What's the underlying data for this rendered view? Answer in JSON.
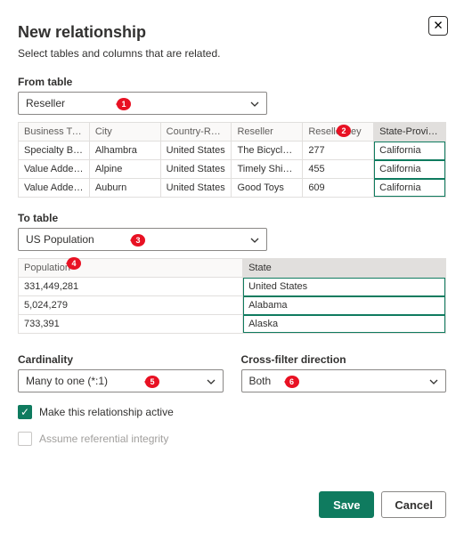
{
  "title": "New relationship",
  "subtitle": "Select tables and columns that are related.",
  "close_icon": "✕",
  "from": {
    "label": "From table",
    "selected": "Reseller",
    "columns": [
      "Business Type",
      "City",
      "Country-Regi…",
      "Reseller",
      "ResellerKey",
      "State-Province"
    ],
    "rows": [
      [
        "Specialty Bike…",
        "Alhambra",
        "United States",
        "The Bicycle A…",
        "277",
        "California"
      ],
      [
        "Value Added …",
        "Alpine",
        "United States",
        "Timely Shippi…",
        "455",
        "California"
      ],
      [
        "Value Added …",
        "Auburn",
        "United States",
        "Good Toys",
        "609",
        "California"
      ]
    ],
    "selected_col_index": 5
  },
  "to": {
    "label": "To table",
    "selected": "US Population",
    "columns": [
      "Population",
      "State"
    ],
    "rows": [
      [
        "331,449,281",
        "United States"
      ],
      [
        "5,024,279",
        "Alabama"
      ],
      [
        "733,391",
        "Alaska"
      ]
    ],
    "selected_col_index": 1
  },
  "cardinality": {
    "label": "Cardinality",
    "selected": "Many to one (*:1)"
  },
  "crossfilter": {
    "label": "Cross-filter direction",
    "selected": "Both"
  },
  "check_active": {
    "label": "Make this relationship active",
    "checked": true
  },
  "check_referential": {
    "label": "Assume referential integrity",
    "checked": false,
    "disabled": true
  },
  "buttons": {
    "save": "Save",
    "cancel": "Cancel"
  },
  "callouts": {
    "c1": "1",
    "c2": "2",
    "c3": "3",
    "c4": "4",
    "c5": "5",
    "c6": "6"
  }
}
